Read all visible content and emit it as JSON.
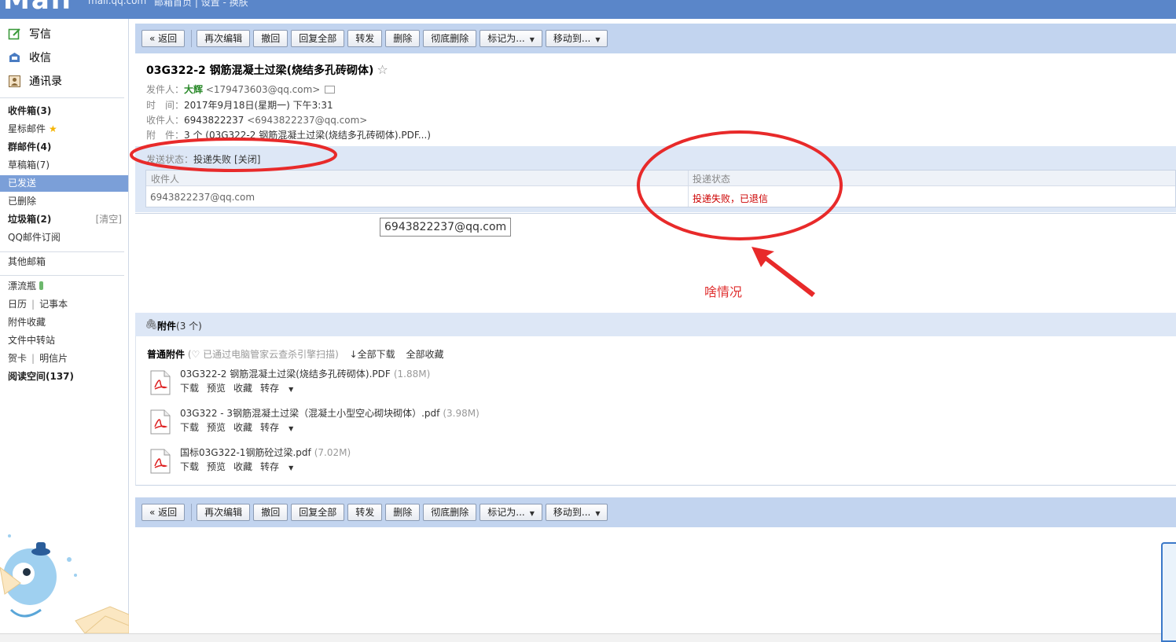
{
  "topbar": {
    "logo": "Mail",
    "site": "mail.qq.com",
    "links": "邮箱首页 | 设置 - 换肤"
  },
  "sidebar": {
    "actions": [
      {
        "label": "写信",
        "icon": "write-icon"
      },
      {
        "label": "收信",
        "icon": "inbox-icon"
      },
      {
        "label": "通讯录",
        "icon": "contacts-icon"
      }
    ],
    "folders": [
      {
        "label": "收件箱(3)",
        "bold": true
      },
      {
        "label": "星标邮件",
        "bold": false
      },
      {
        "label": "群邮件(4)",
        "bold": true
      },
      {
        "label": "草稿箱(7)",
        "bold": false
      },
      {
        "label": "已发送",
        "bold": false,
        "active": true
      },
      {
        "label": "已删除",
        "bold": false
      },
      {
        "label": "垃圾箱(2)",
        "bold": true,
        "right": "[清空]"
      },
      {
        "label": "QQ邮件订阅",
        "bold": false
      }
    ],
    "other_mailbox": "其他邮箱",
    "tools": {
      "bottle": "漂流瓶",
      "calendar": "日历",
      "notebook": "记事本",
      "attach_collect": "附件收藏",
      "file_transfer": "文件中转站",
      "card": "贺卡",
      "postcard": "明信片",
      "reading": "阅读空间(137)"
    }
  },
  "toolbar": {
    "back": "« 返回",
    "reedit": "再次编辑",
    "recall": "撤回",
    "reply_all": "回复全部",
    "forward": "转发",
    "delete": "删除",
    "delete_forever": "彻底删除",
    "mark_as": "标记为...",
    "move_to": "移动到..."
  },
  "mail": {
    "subject": "03G322-2 钢筋混凝土过梁(烧结多孔砖砌体)",
    "star": "☆",
    "sender_label": "发件人：",
    "sender_name": "大辉",
    "sender_addr": "<179473603@qq.com>",
    "time_label": "时　间：",
    "time_value": "2017年9月18日(星期一) 下午3:31",
    "recipient_label": "收件人：",
    "recipient_name": "6943822237",
    "recipient_addr": "<6943822237@qq.com>",
    "attach_label": "附　件：",
    "attach_value": "3 个 (03G322-2 钢筋混凝土过梁(烧结多孔砖砌体).PDF...)"
  },
  "send_status": {
    "label": "发送状态：",
    "value": "投递失败",
    "close": "[关闭]",
    "col_recipient": "收件人",
    "col_status": "投递状态",
    "row_addr": "6943822237@qq.com",
    "row_status": "投递失败，已退信"
  },
  "tooltip": "6943822237@qq.com",
  "annotation": {
    "text": "啥情况",
    "color": "#e03030"
  },
  "attachments": {
    "header_title": "附件",
    "header_count": "(3 个)",
    "sub_title": "普通附件",
    "scan_note": "(♡ 已通过电脑管家云查杀引擎扫描)",
    "download_all": "全部下载",
    "collect_all": "全部收藏",
    "op_download": "下载",
    "op_preview": "预览",
    "op_collect": "收藏",
    "op_transfer": "转存",
    "files": [
      {
        "name": "03G322-2 钢筋混凝土过梁(烧结多孔砖砌体).PDF",
        "size": "(1.88M)"
      },
      {
        "name": "03G322 - 3钢筋混凝土过梁（混凝土小型空心砌块砌体）.pdf",
        "size": "(3.98M)"
      },
      {
        "name": "国标03G322-1钢筋砼过梁.pdf",
        "size": "(7.02M)"
      }
    ]
  }
}
